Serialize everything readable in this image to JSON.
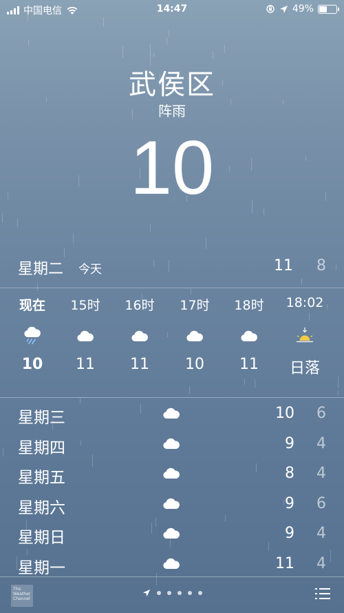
{
  "status_bar": {
    "carrier": "中国电信",
    "time": "14:47",
    "battery": "49%",
    "battery_level": 0.49
  },
  "location": {
    "city": "武侯区",
    "condition": "阵雨",
    "temperature": "10"
  },
  "today": {
    "day": "星期二",
    "label": "今天",
    "high": "11",
    "low": "8"
  },
  "hourly": [
    {
      "time": "现在",
      "icon": "rain-cloud-icon",
      "temp": "10"
    },
    {
      "time": "15时",
      "icon": "cloud-icon",
      "temp": "11"
    },
    {
      "time": "16时",
      "icon": "cloud-icon",
      "temp": "11"
    },
    {
      "time": "17时",
      "icon": "cloud-icon",
      "temp": "10"
    },
    {
      "time": "18时",
      "icon": "cloud-icon",
      "temp": "11"
    },
    {
      "time": "18:02",
      "icon": "sunset-icon",
      "temp": "日落"
    }
  ],
  "daily": [
    {
      "day": "星期三",
      "icon": "cloud-icon",
      "high": "10",
      "low": "6"
    },
    {
      "day": "星期四",
      "icon": "cloud-icon",
      "high": "9",
      "low": "4"
    },
    {
      "day": "星期五",
      "icon": "cloud-icon",
      "high": "8",
      "low": "4"
    },
    {
      "day": "星期六",
      "icon": "cloud-icon",
      "high": "9",
      "low": "6"
    },
    {
      "day": "星期日",
      "icon": "cloud-icon",
      "high": "9",
      "low": "4"
    },
    {
      "day": "星期一",
      "icon": "cloud-icon",
      "high": "11",
      "low": "4"
    }
  ],
  "footer": {
    "logo_text": "The Weather Channel",
    "page_count": 5
  },
  "colors": {
    "sunset": "#f5c94a"
  }
}
